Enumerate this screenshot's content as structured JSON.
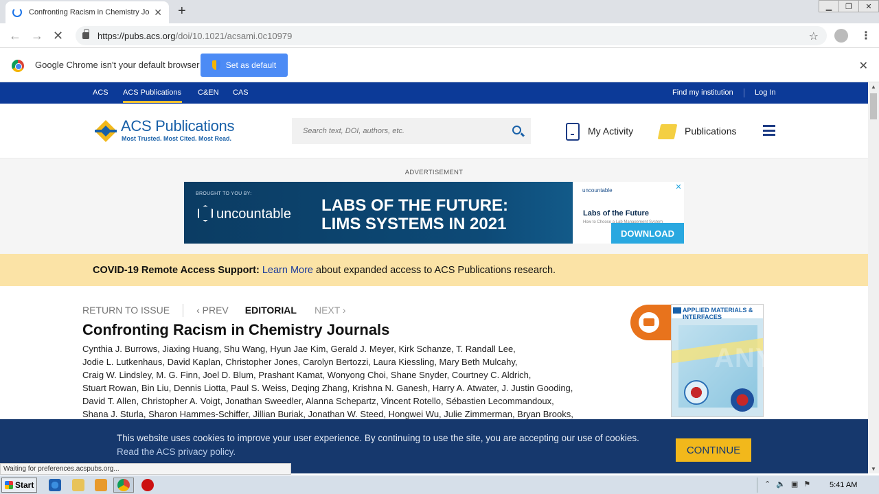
{
  "browser": {
    "tab_title": "Confronting Racism in Chemistry Jou",
    "new_tab": "+",
    "url_host": "https://pubs.acs.org",
    "url_path": "/doi/10.1021/acsami.0c10979",
    "infobar_text": "Google Chrome isn't your default browser",
    "set_default_label": "Set as default",
    "status_text": "Waiting for preferences.acspubs.org..."
  },
  "topnav": {
    "links": [
      "ACS",
      "ACS Publications",
      "C&EN",
      "CAS"
    ],
    "find_institution": "Find my institution",
    "login": "Log In"
  },
  "header": {
    "logo_name": "ACS Publications",
    "logo_tagline": "Most Trusted. Most Cited. Most Read.",
    "search_placeholder": "Search text, DOI, authors, etc.",
    "my_activity": "My Activity",
    "publications": "Publications"
  },
  "ad": {
    "label": "ADVERTISEMENT",
    "brought_by": "BROUGHT TO YOU BY:",
    "brand": "uncountable",
    "headline1": "LABS OF THE FUTURE:",
    "headline2": "LIMS SYSTEMS IN 2021",
    "card_brand": "uncountable",
    "card_title": "Labs of the Future",
    "card_sub": "How to Choose a Lab Management System",
    "download": "DOWNLOAD",
    "close": "✕"
  },
  "covid": {
    "bold": "COVID-19 Remote Access Support:",
    "link": "Learn More",
    "rest": "about expanded access to ACS Publications research."
  },
  "article": {
    "return": "RETURN TO ISSUE",
    "prev": "‹ PREV",
    "type": "EDITORIAL",
    "next": "NEXT ›",
    "title": "Confronting Racism in Chemistry Journals",
    "author_lines": [
      "Cynthia J. Burrows, Jiaxing Huang, Shu Wang, Hyun Jae Kim, Gerald J. Meyer, Kirk Schanze, T. Randall Lee,",
      "Jodie L. Lutkenhaus, David Kaplan, Christopher Jones, Carolyn Bertozzi, Laura Kiessling, Mary Beth Mulcahy,",
      "Craig W. Lindsley, M. G. Finn, Joel D. Blum, Prashant Kamat, Wonyong Choi, Shane Snyder, Courtney C. Aldrich,",
      "Stuart Rowan, Bin Liu, Dennis Liotta, Paul S. Weiss, Deqing Zhang, Krishna N. Ganesh, Harry A. Atwater, J. Justin Gooding,",
      "David T. Allen, Christopher A. Voigt, Jonathan Sweedler, Alanna Schepartz, Vincent Rotello, Sébastien Lecommandoux,",
      "Shana J. Sturla, Sharon Hammes-Schiffer, Jillian Buriak, Jonathan W. Steed, Hongwei Wu, Julie Zimmerman, Bryan Brooks,"
    ]
  },
  "cover": {
    "title": "APPLIED MATERIALS & INTERFACES"
  },
  "cookie": {
    "text": "This website uses cookies to improve your user experience. By continuing to use the site, you are accepting our use of cookies.",
    "link": "Read the ACS privacy policy.",
    "button": "CONTINUE"
  },
  "watermark": "ANY RUN",
  "taskbar": {
    "start": "Start",
    "clock": "5:41 AM"
  },
  "colors": {
    "topnav": "#0c3a98",
    "brand_blue": "#1860a8",
    "covid_banner": "#fbe3a6",
    "cookie_bar": "#16386d",
    "cookie_button": "#f2b81b",
    "fab": "#e8731c"
  }
}
